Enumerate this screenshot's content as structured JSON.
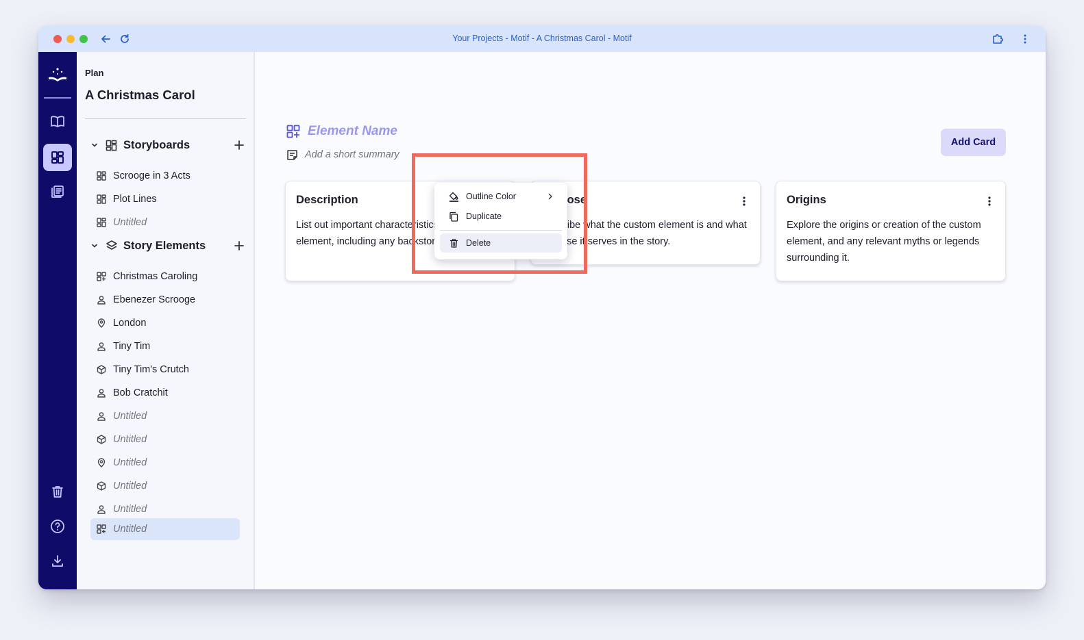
{
  "window": {
    "title": "Your Projects - Motif - A Christmas Carol - Motif"
  },
  "sidebar": {
    "section_label": "Plan",
    "project_title": "A Christmas Carol",
    "storyboards": {
      "label": "Storyboards",
      "items": [
        {
          "label": "Scrooge in 3 Acts",
          "icon": "storyboard-icon"
        },
        {
          "label": "Plot Lines",
          "icon": "storyboard-icon"
        },
        {
          "label": "Untitled",
          "icon": "storyboard-icon"
        }
      ]
    },
    "story_elements": {
      "label": "Story Elements",
      "items": [
        {
          "label": "Christmas Caroling",
          "icon": "custom-element-icon"
        },
        {
          "label": "Ebenezer Scrooge",
          "icon": "person-icon"
        },
        {
          "label": "London",
          "icon": "location-pin-icon"
        },
        {
          "label": "Tiny Tim",
          "icon": "person-icon"
        },
        {
          "label": "Tiny Tim's Crutch",
          "icon": "item-cube-icon"
        },
        {
          "label": "Bob Cratchit",
          "icon": "person-icon"
        },
        {
          "label": "Untitled",
          "icon": "person-icon"
        },
        {
          "label": "Untitled",
          "icon": "item-cube-icon"
        },
        {
          "label": "Untitled",
          "icon": "location-pin-icon"
        },
        {
          "label": "Untitled",
          "icon": "item-cube-icon"
        },
        {
          "label": "Untitled",
          "icon": "person-icon"
        },
        {
          "label": "Untitled",
          "icon": "custom-element-icon",
          "selected": true
        }
      ]
    }
  },
  "main": {
    "element_name_placeholder": "Element Name",
    "summary_placeholder": "Add a short summary",
    "add_card_label": "Add Card",
    "cards": [
      {
        "title": "Description",
        "body": "List out important characteristics of the custom element, including any backstory or history."
      },
      {
        "title": "Purpose",
        "body": "Describe what the custom element is and what purpose it serves in the story."
      },
      {
        "title": "Origins",
        "body": "Explore the origins or creation of the custom element, and any relevant myths or legends surrounding it."
      }
    ]
  },
  "context_menu": {
    "items": [
      {
        "label": "Outline Color",
        "icon": "paint-bucket-icon",
        "has_submenu": true
      },
      {
        "label": "Duplicate",
        "icon": "copy-icon"
      },
      {
        "label": "Delete",
        "icon": "trash-icon",
        "hovered": true
      }
    ]
  },
  "colors": {
    "rail_bg": "#0f0c69",
    "accent": "#5955d8",
    "highlight": "#ef6a5c",
    "titlebar": "#d8e4fb"
  }
}
